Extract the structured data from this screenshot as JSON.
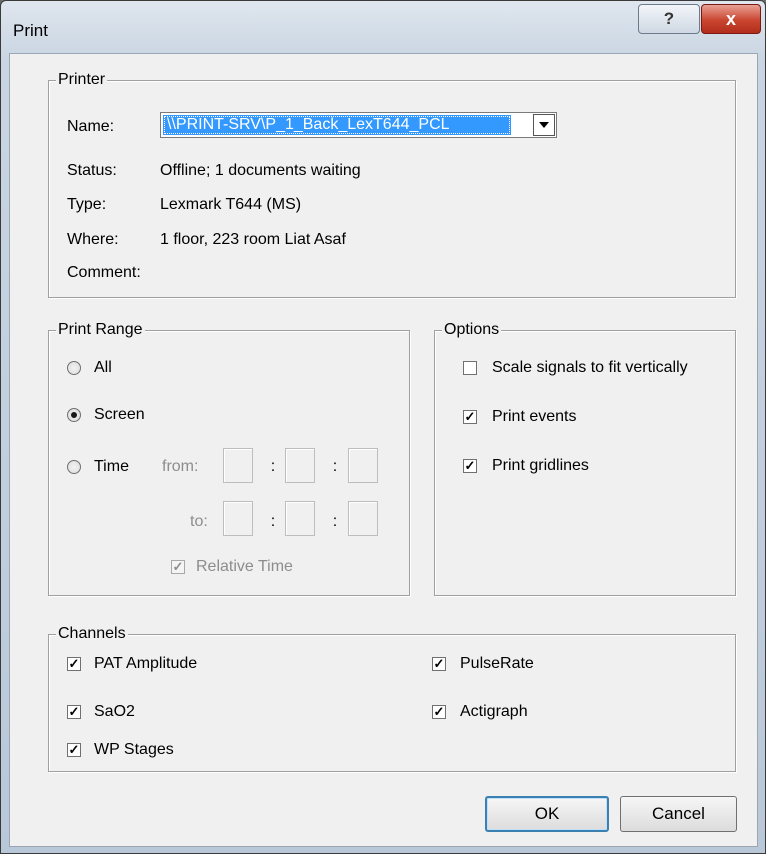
{
  "window": {
    "title": "Print",
    "help_glyph": "?",
    "close_glyph": "x"
  },
  "printer": {
    "legend": "Printer",
    "name_label": "Name:",
    "name_value": "\\\\PRINT-SRV\\P_1_Back_LexT644_PCL",
    "status_label": "Status:",
    "status_value": "Offline; 1 documents waiting",
    "type_label": "Type:",
    "type_value": "Lexmark T644 (MS)",
    "where_label": "Where:",
    "where_value": "1 floor, 223 room Liat Asaf",
    "comment_label": "Comment:"
  },
  "print_range": {
    "legend": "Print Range",
    "all_label": "All",
    "screen_label": "Screen",
    "time_label": "Time",
    "from_label": "from:",
    "to_label": "to:",
    "colon": ":",
    "relative_time_label": "Relative Time",
    "selected": "Screen"
  },
  "options": {
    "legend": "Options",
    "scale_label": "Scale signals to fit vertically",
    "scale_checked": false,
    "events_label": "Print events",
    "events_checked": true,
    "gridlines_label": "Print gridlines",
    "gridlines_checked": true
  },
  "channels": {
    "legend": "Channels",
    "items": [
      {
        "label": "PAT Amplitude",
        "checked": true
      },
      {
        "label": "SaO2",
        "checked": true
      },
      {
        "label": "WP Stages",
        "checked": true
      },
      {
        "label": "PulseRate",
        "checked": true
      },
      {
        "label": "Actigraph",
        "checked": true
      }
    ]
  },
  "buttons": {
    "ok": "OK",
    "cancel": "Cancel"
  },
  "colors": {
    "selection": "#3399ff",
    "dialog_bg": "#f0f0f0",
    "close_red": "#c9452f"
  }
}
